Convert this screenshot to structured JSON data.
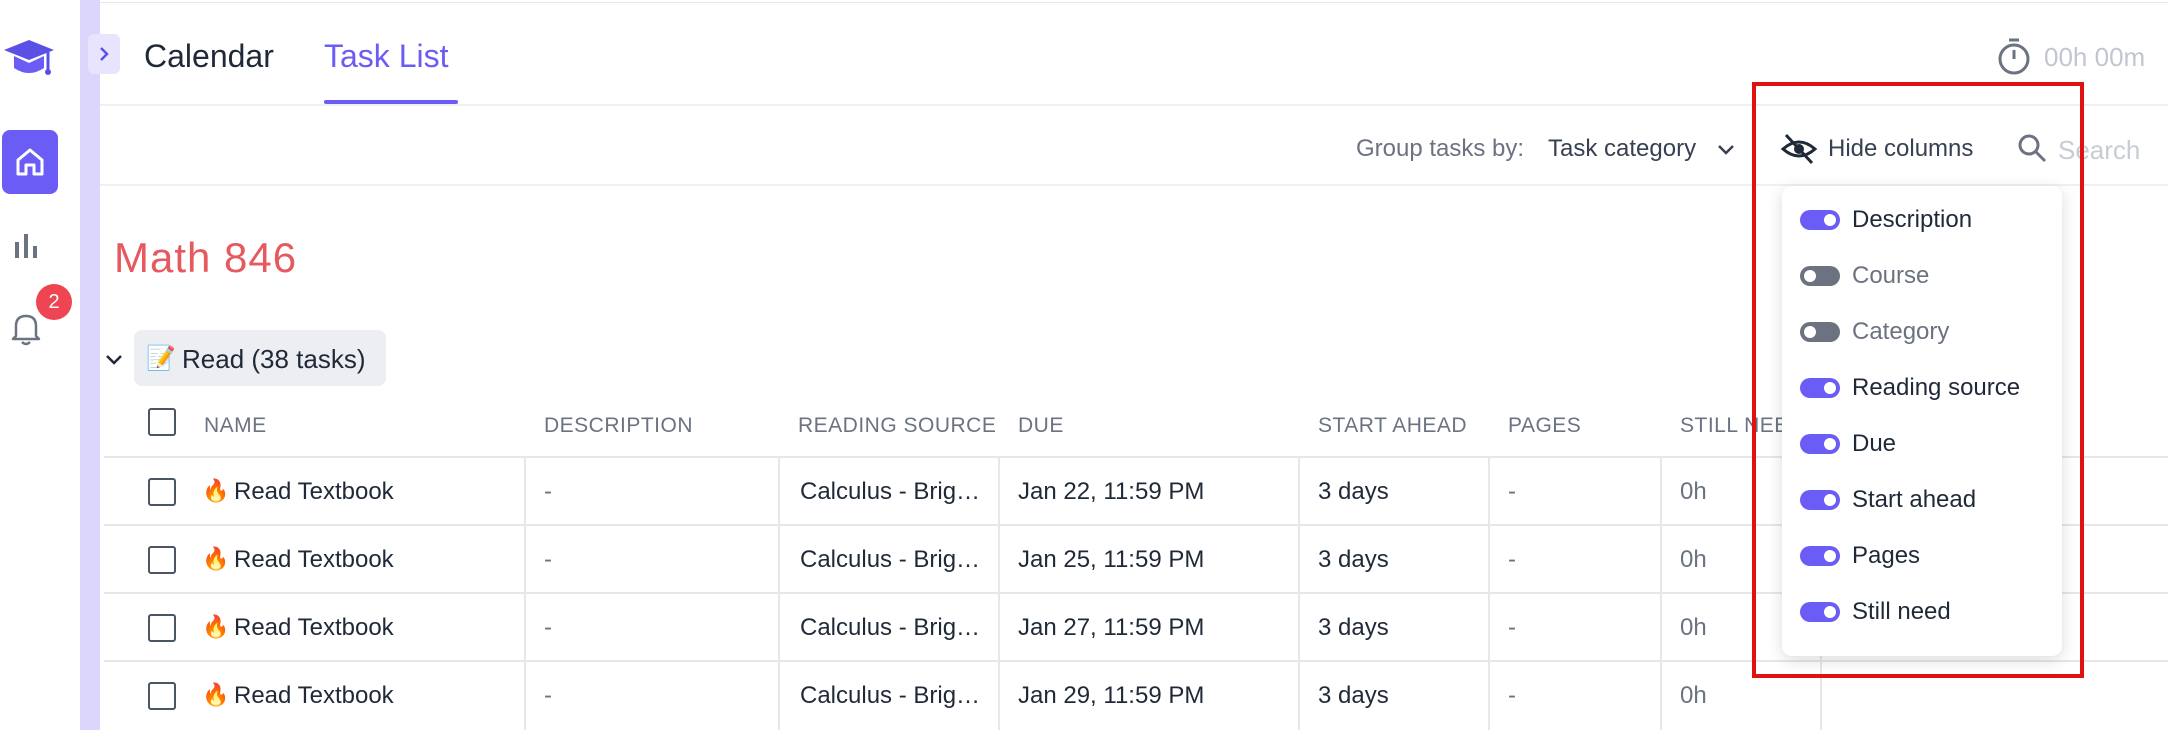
{
  "rail": {
    "notification_count": "2"
  },
  "tabs": [
    {
      "label": "Calendar",
      "active": false
    },
    {
      "label": "Task List",
      "active": true
    }
  ],
  "timer": {
    "text": "00h 00m"
  },
  "toolbar": {
    "group_label": "Group tasks by:",
    "group_value": "Task category",
    "hide_columns_label": "Hide columns",
    "search_placeholder": "Search"
  },
  "course": {
    "title": "Math 846"
  },
  "group": {
    "emoji": "📝",
    "label": "Read (38 tasks)"
  },
  "table": {
    "columns": [
      "NAME",
      "DESCRIPTION",
      "READING SOURCE",
      "DUE",
      "START AHEAD",
      "PAGES",
      "STILL NEE"
    ],
    "rows": [
      {
        "name": "Read Textbook",
        "description": "-",
        "reading_source": "Calculus - Brig…",
        "due": "Jan 22, 11:59 PM",
        "start_ahead": "3 days",
        "pages": "-",
        "still_need": "0h"
      },
      {
        "name": "Read Textbook",
        "description": "-",
        "reading_source": "Calculus - Brig…",
        "due": "Jan 25, 11:59 PM",
        "start_ahead": "3 days",
        "pages": "-",
        "still_need": "0h"
      },
      {
        "name": "Read Textbook",
        "description": "-",
        "reading_source": "Calculus - Brig…",
        "due": "Jan 27, 11:59 PM",
        "start_ahead": "3 days",
        "pages": "-",
        "still_need": "0h"
      },
      {
        "name": "Read Textbook",
        "description": "-",
        "reading_source": "Calculus - Brig…",
        "due": "Jan 29, 11:59 PM",
        "start_ahead": "3 days",
        "pages": "-",
        "still_need": "0h"
      }
    ]
  },
  "hide_columns_menu": {
    "options": [
      {
        "label": "Description",
        "enabled": true
      },
      {
        "label": "Course",
        "enabled": false
      },
      {
        "label": "Category",
        "enabled": false
      },
      {
        "label": "Reading source",
        "enabled": true
      },
      {
        "label": "Due",
        "enabled": true
      },
      {
        "label": "Start ahead",
        "enabled": true
      },
      {
        "label": "Pages",
        "enabled": true
      },
      {
        "label": "Still need",
        "enabled": true
      }
    ]
  },
  "colors": {
    "accent": "#6b5cf6",
    "course_title": "#e5595f",
    "badge": "#ef4452",
    "highlight_border": "#e01111"
  }
}
